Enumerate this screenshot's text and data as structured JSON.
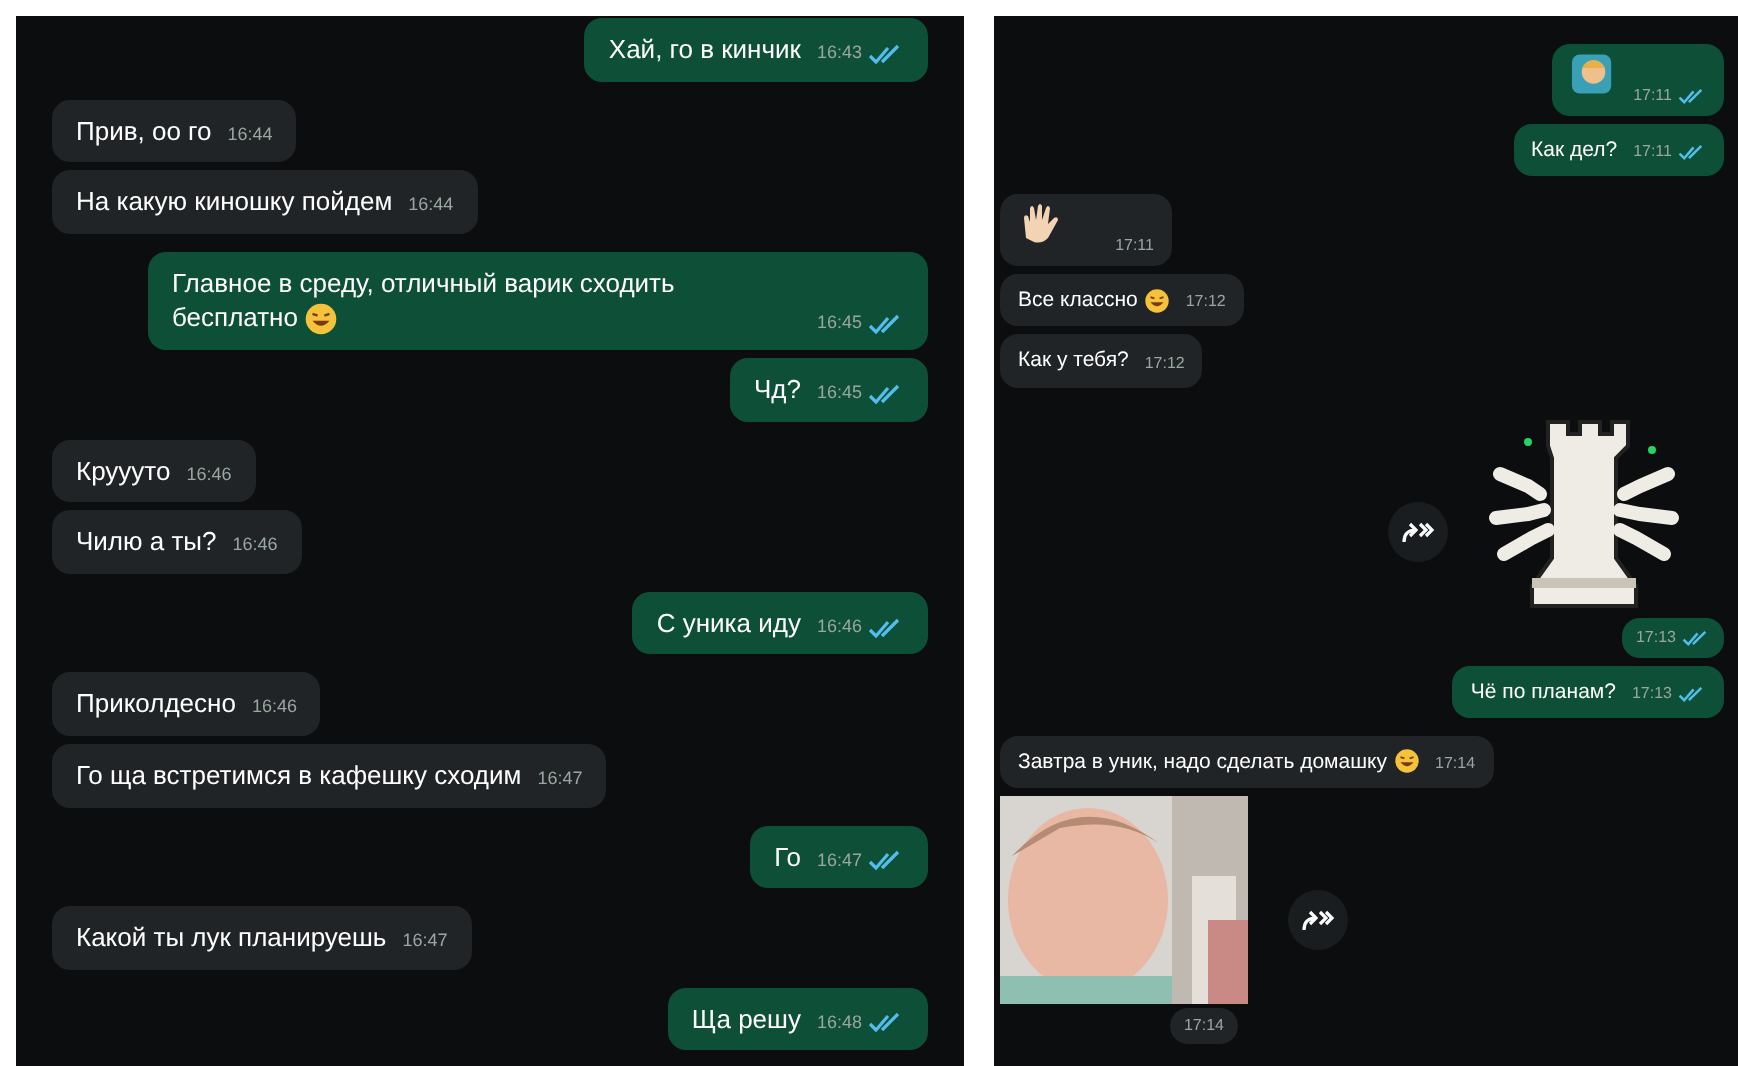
{
  "panels": [
    {
      "messages": [
        {
          "kind": "text",
          "outgoing": true,
          "text": "Хай, го в кинчик",
          "time": "16:43",
          "read": true
        },
        {
          "kind": "text",
          "outgoing": false,
          "text": "Прив, оо го",
          "time": "16:44"
        },
        {
          "kind": "text",
          "outgoing": false,
          "text": "На какую киношку пойдем",
          "time": "16:44"
        },
        {
          "kind": "text",
          "outgoing": true,
          "text": "Главное в среду, отличный варик сходить бесплатно",
          "time": "16:45",
          "read": true,
          "emoji": true
        },
        {
          "kind": "text",
          "outgoing": true,
          "text": "Чд?",
          "time": "16:45",
          "read": true
        },
        {
          "kind": "text",
          "outgoing": false,
          "text": "Круууто",
          "time": "16:46"
        },
        {
          "kind": "text",
          "outgoing": false,
          "text": "Чилю а ты?",
          "time": "16:46"
        },
        {
          "kind": "text",
          "outgoing": true,
          "text": "С уника иду",
          "time": "16:46",
          "read": true
        },
        {
          "kind": "text",
          "outgoing": false,
          "text": "Приколдесно",
          "time": "16:46"
        },
        {
          "kind": "text",
          "outgoing": false,
          "text": "Го ща встретимся в кафешку сходим",
          "time": "16:47"
        },
        {
          "kind": "text",
          "outgoing": true,
          "text": "Го",
          "time": "16:47",
          "read": true
        },
        {
          "kind": "text",
          "outgoing": false,
          "text": "Какой ты лук планируешь",
          "time": "16:47"
        },
        {
          "kind": "text",
          "outgoing": true,
          "text": "Ща решу",
          "time": "16:48",
          "read": true
        }
      ]
    },
    {
      "messages": [
        {
          "kind": "emoji",
          "outgoing": true,
          "time": "17:11",
          "read": true
        },
        {
          "kind": "text",
          "outgoing": true,
          "text": "Как дел?",
          "time": "17:11",
          "read": true
        },
        {
          "kind": "emoji",
          "outgoing": false,
          "time": "17:11"
        },
        {
          "kind": "text",
          "outgoing": false,
          "text": "Все классно",
          "time": "17:12",
          "emoji": true
        },
        {
          "kind": "text",
          "outgoing": false,
          "text": "Как у тебя?",
          "time": "17:12"
        },
        {
          "kind": "sticker",
          "outgoing": true,
          "time": "17:13",
          "read": true,
          "forward": true
        },
        {
          "kind": "text",
          "outgoing": true,
          "text": "Чё по планам?",
          "time": "17:13",
          "read": true
        },
        {
          "kind": "text",
          "outgoing": false,
          "text": "Завтра в уник, надо сделать домашку",
          "time": "17:14",
          "emoji": true
        },
        {
          "outgoing": false,
          "time": "17:14",
          "forward": true
        }
      ]
    }
  ]
}
